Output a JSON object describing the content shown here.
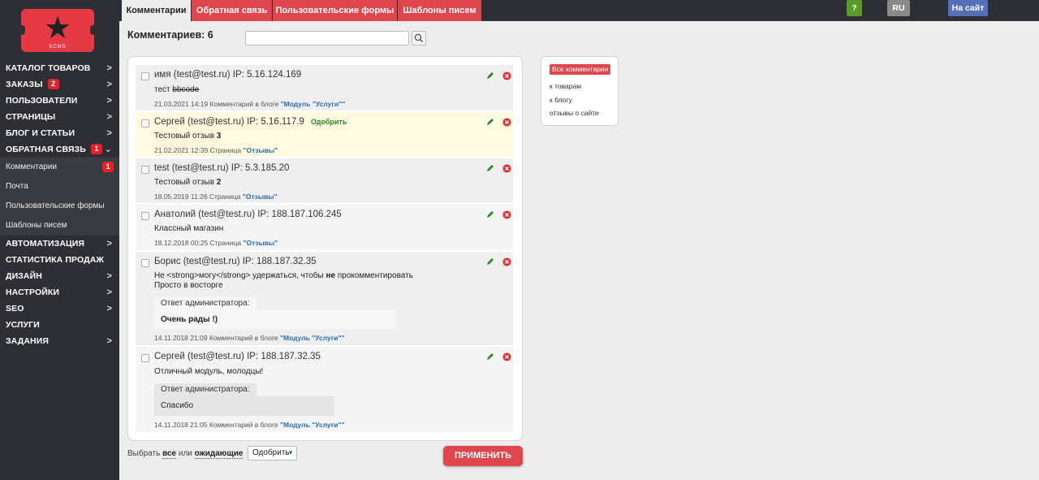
{
  "logo": {
    "text": "SCMS"
  },
  "sidebar": {
    "items": [
      {
        "label": "Каталог товаров"
      },
      {
        "label": "Заказы",
        "badge": "2"
      },
      {
        "label": "Пользователи"
      },
      {
        "label": "Страницы"
      },
      {
        "label": "Блог и статьи"
      },
      {
        "label": "Обратная связь",
        "badge": "1"
      },
      {
        "label": "Автоматизация"
      },
      {
        "label": "Статистика продаж"
      },
      {
        "label": "Дизайн"
      },
      {
        "label": "Настройки"
      },
      {
        "label": "SEO"
      },
      {
        "label": "Услуги"
      },
      {
        "label": "Задания"
      }
    ],
    "subitems": [
      {
        "label": "Комментарии",
        "badge": "1"
      },
      {
        "label": "Почта"
      },
      {
        "label": "Пользовательские формы"
      },
      {
        "label": "Шаблоны писем"
      }
    ]
  },
  "tabs": [
    "Комментарии",
    "Обратная связь",
    "Пользовательские формы",
    "Шаблоны писем"
  ],
  "topbar": {
    "help": "?",
    "lang": "RU",
    "site": "На сайт"
  },
  "header": {
    "title": "Комментариев: 6",
    "search_value": ""
  },
  "comments": [
    {
      "author": "имя (test@test.ru) IP: 5.16.124.169",
      "text_a": "тест ",
      "text_strike": "bbcode",
      "meta": "21.03.2021 14:19 Комментарий в блоге ",
      "meta_link": "\"Модуль \"Услуги\"\""
    },
    {
      "author": "Сергей (test@test.ru) IP: 5.16.117.9",
      "approve": "Одобрить",
      "text_a": "Тестовый отзыв ",
      "text_b": "3",
      "meta": "21.02.2021 12:39 Страница ",
      "meta_link": "\"Отзывы\""
    },
    {
      "author": "test (test@test.ru) IP: 5.3.185.20",
      "text_a": "Тестовый отзыв ",
      "text_b": "2",
      "meta": "18.05.2019 11:26 Страница ",
      "meta_link": "\"Отзывы\""
    },
    {
      "author": "Анатолий (test@test.ru) IP: 188.187.106.245",
      "text_a": "Классный магазин",
      "meta": "18.12.2018 00:25 Страница ",
      "meta_link": "\"Отзывы\""
    },
    {
      "author": "Борис (test@test.ru) IP: 188.187.32.35",
      "text_a": "Не <strong>могу</strong> удержаться, чтобы ",
      "text_b": "не",
      "text_c": " прокомментировать",
      "text_line2": "Просто в восторге",
      "reply_label": "Ответ администратора:",
      "reply_text": "Очень рады !)",
      "meta": "14.11.2018 21:09 Комментарий в блоге ",
      "meta_link": "\"Модуль \"Услуги\"\""
    },
    {
      "author": "Сергей (test@test.ru) IP: 188.187.32.35",
      "text_a": "Отличный модуль, молодцы!",
      "reply_label": "Ответ администратора:",
      "reply_text": "Спасибо",
      "meta": "14.11.2018 21:05 Комментарий в блоге ",
      "meta_link": "\"Модуль \"Услуги\"\""
    }
  ],
  "bottom": {
    "select_prefix": "Выбрать ",
    "select_all": "все",
    "select_or": " или ",
    "select_pending": "ожидающие",
    "action": "Одобрить",
    "apply": "ПРИМЕНИТЬ"
  },
  "filter": {
    "all": "Все комментарии",
    "links": [
      "к товарам",
      "к блогу",
      "отзывы о сайте"
    ]
  },
  "colors": {
    "accent": "#e0464d",
    "sidebar": "#2e2f35",
    "approve": "#2a8a2a",
    "link": "#2a6db0",
    "help_btn": "#5a9a2a",
    "site_btn": "#5470b8"
  }
}
